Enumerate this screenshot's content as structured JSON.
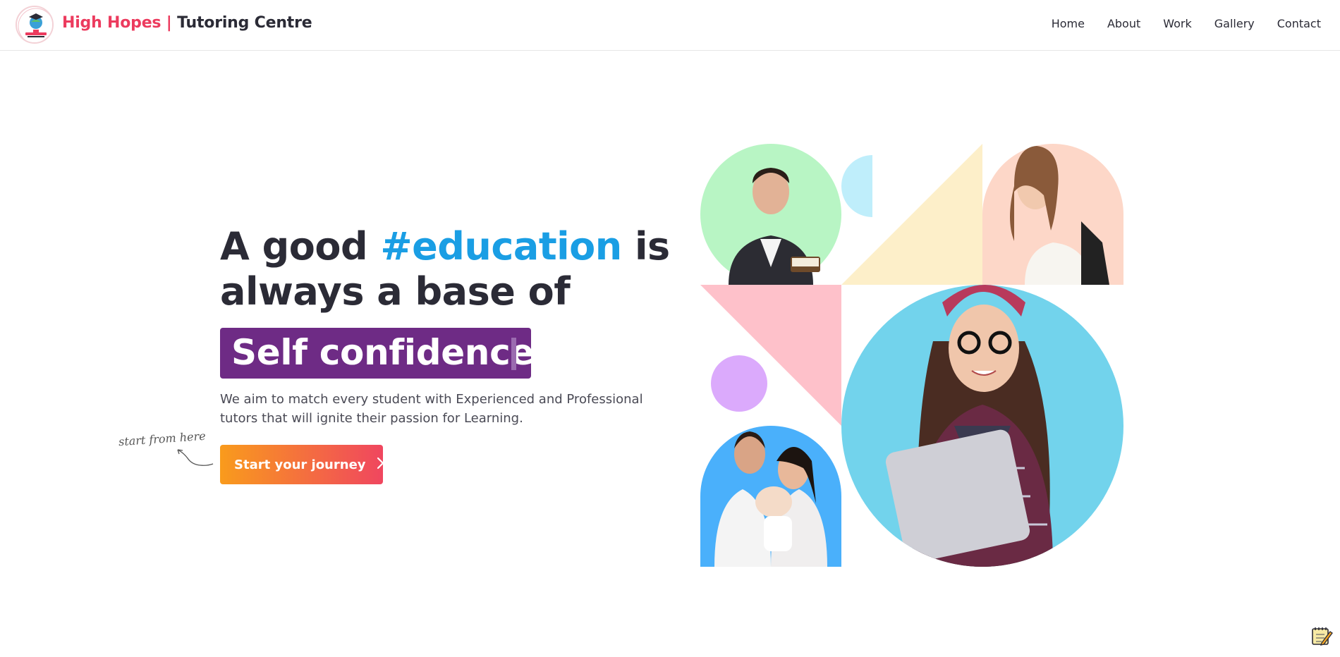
{
  "header": {
    "brand_primary": "High Hopes",
    "brand_separator": "|",
    "brand_secondary": "Tutoring Centre",
    "logo_icon": "graduation-globe-logo-icon",
    "nav": [
      {
        "label": "Home"
      },
      {
        "label": "About"
      },
      {
        "label": "Work"
      },
      {
        "label": "Gallery"
      },
      {
        "label": "Contact"
      }
    ]
  },
  "hero": {
    "headline_part1": "A good ",
    "headline_hashtag": "#education",
    "headline_part2": " is always a base of",
    "typed_word": "Self confidence",
    "tagline": "We aim to match every student with Experienced and Professional tutors that will ignite their passion for Learning.",
    "hint": "start from here",
    "cta_label": "Start your journey"
  },
  "colors": {
    "brand_pink": "#ec3b5e",
    "hashtag_blue": "#1a9ee4",
    "typed_bg": "#6e2b85",
    "cta_gradient_start": "#f99b1c",
    "cta_gradient_end": "#f0465f",
    "text_dark": "#2b2b36"
  },
  "icons": {
    "cta_icon": "chevron-right-icon",
    "corner_icon": "notepad-pencil-icon"
  }
}
